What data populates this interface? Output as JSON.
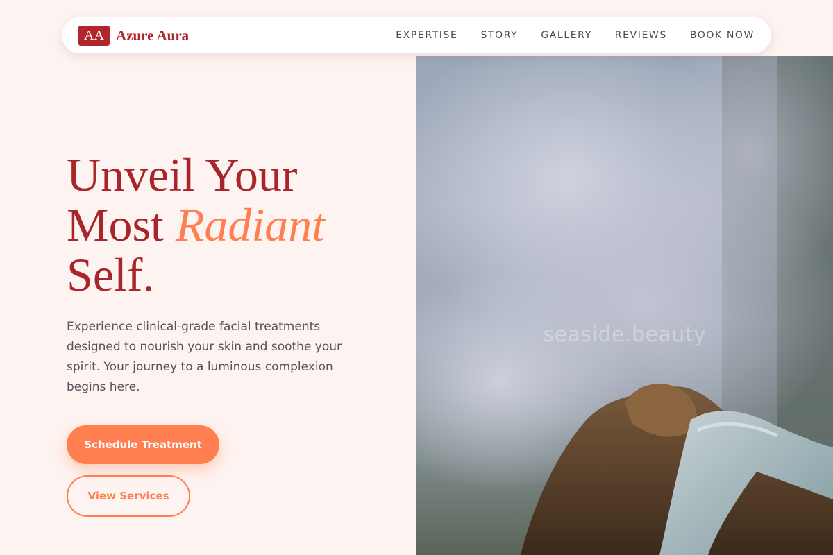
{
  "brand": {
    "badge": "AA",
    "name": "Azure Aura",
    "color": "#b2262b"
  },
  "nav": {
    "links": [
      "EXPERTISE",
      "STORY",
      "GALLERY",
      "REVIEWS",
      "BOOK NOW"
    ]
  },
  "hero": {
    "title_line1": "Unveil Your",
    "title_line2_prefix": "Most",
    "title_accent": "Radiant",
    "title_line3": "Self.",
    "description": "Experience clinical-grade facial treatments designed to nourish your skin and soothe your spirit. Your journey to a luminous complexion begins here.",
    "primary_button": "Schedule Treatment",
    "secondary_button": "View Services",
    "accent_color": "#ff7f50",
    "image_watermark": "seaside.beauty"
  }
}
